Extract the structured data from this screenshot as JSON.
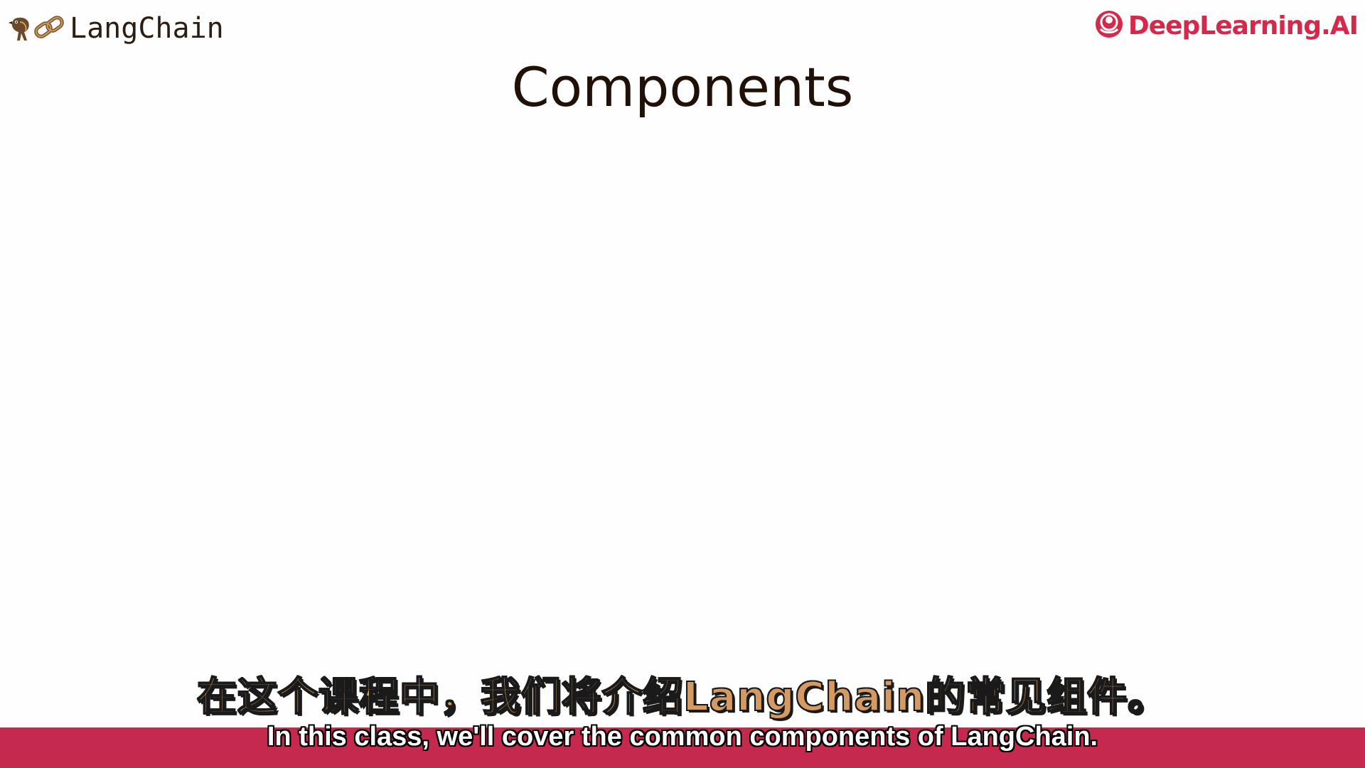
{
  "header": {
    "left_logo_text": "LangChain",
    "right_logo_text": "DeepLearning.AI"
  },
  "slide": {
    "title": "Components"
  },
  "subtitles": {
    "chinese": "在这个课程中，我们将介绍LangChain的常见组件。",
    "english": "In this class, we'll cover the common components of LangChain."
  },
  "colors": {
    "brand_red": "#d4294b",
    "subtitle_band": "#c52a4e",
    "subtitle_zh_fill": "#d49a62"
  }
}
